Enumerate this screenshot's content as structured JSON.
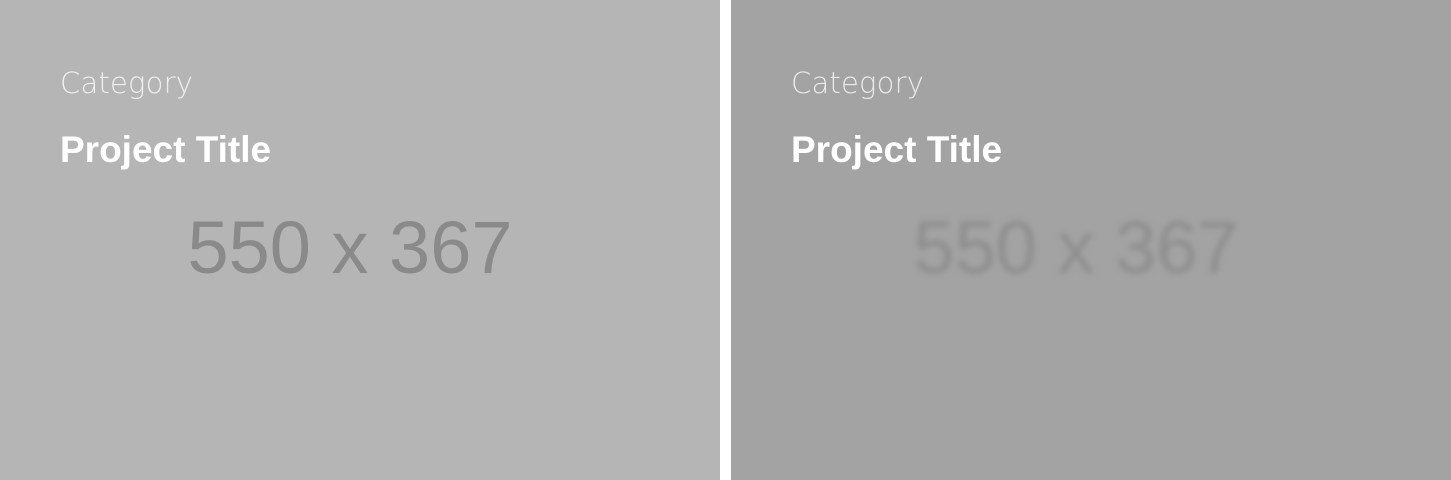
{
  "portfolio": {
    "items": [
      {
        "category": "Category",
        "title": "Project Title",
        "image_placeholder": "550 x 367",
        "background": "#b5b5b5"
      },
      {
        "category": "Category",
        "title": "Project Title",
        "image_placeholder": "550 x 367",
        "background": "#a3a3a3"
      }
    ]
  }
}
